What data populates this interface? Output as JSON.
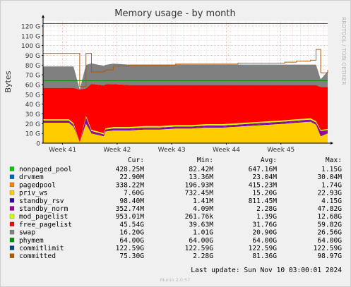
{
  "chart_data": {
    "type": "area",
    "title": "Memory usage - by month",
    "ylabel": "Bytes",
    "watermark": "RRDTOOL / TOBI OETIKER",
    "footer": "Munin 2.0.57",
    "last_update": "Last update: Sun Nov 10 03:00:01 2024",
    "grid": true,
    "ylim": [
      0,
      125
    ],
    "y_unit": "G",
    "y_ticks": [
      "0",
      "10 G",
      "20 G",
      "30 G",
      "40 G",
      "50 G",
      "60 G",
      "70 G",
      "80 G",
      "90 G",
      "100 G",
      "110 G",
      "120 G"
    ],
    "x_ticks": [
      "Week 41",
      "Week 42",
      "Week 43",
      "Week 44",
      "Week 45"
    ],
    "x_range_days": [
      0,
      36.5
    ],
    "x_tick_days": [
      2.5,
      9.5,
      16.5,
      23.5,
      30.5
    ],
    "table_headers": [
      "Cur:",
      "Min:",
      "Avg:",
      "Max:"
    ],
    "legend": [
      {
        "name": "nonpaged_pool",
        "color": "#00cc00",
        "cur": "428.25M",
        "min": "82.42M",
        "avg": "647.16M",
        "max": "1.15G"
      },
      {
        "name": "drvmem",
        "color": "#0066b3",
        "cur": "22.90M",
        "min": "13.36M",
        "avg": "23.04M",
        "max": "30.04M"
      },
      {
        "name": "pagedpool",
        "color": "#ff8000",
        "cur": "338.22M",
        "min": "196.93M",
        "avg": "415.23M",
        "max": "1.74G"
      },
      {
        "name": "priv_ws",
        "color": "#ffcc00",
        "cur": "7.60G",
        "min": "732.45M",
        "avg": "15.20G",
        "max": "22.93G"
      },
      {
        "name": "standby_rsv",
        "color": "#330099",
        "cur": "98.40M",
        "min": "1.41M",
        "avg": "811.45M",
        "max": "4.15G"
      },
      {
        "name": "standby_norm",
        "color": "#990099",
        "cur": "352.74M",
        "min": "4.09M",
        "avg": "2.28G",
        "max": "47.82G"
      },
      {
        "name": "mod_pagelist",
        "color": "#ccff00",
        "cur": "953.01M",
        "min": "261.76k",
        "avg": "1.39G",
        "max": "12.68G"
      },
      {
        "name": "free_pagelist",
        "color": "#ff0000",
        "cur": "45.54G",
        "min": "39.63M",
        "avg": "31.76G",
        "max": "59.82G"
      },
      {
        "name": "swap",
        "color": "#808080",
        "cur": "16.20G",
        "min": "1.01G",
        "avg": "20.90G",
        "max": "26.56G"
      },
      {
        "name": "phymem",
        "color": "#008f00",
        "cur": "64.00G",
        "min": "64.00G",
        "avg": "64.00G",
        "max": "64.00G"
      },
      {
        "name": "commitlimit",
        "color": "#00487d",
        "cur": "122.59G",
        "min": "122.59G",
        "avg": "122.59G",
        "max": "122.59G"
      },
      {
        "name": "committed",
        "color": "#b35a00",
        "cur": "75.30G",
        "min": "2.28G",
        "avg": "81.36G",
        "max": "98.97G"
      }
    ],
    "series_days": [
      0,
      3.3,
      3.9,
      4.7,
      5.5,
      6.2,
      7.8,
      8,
      9,
      11,
      13,
      15,
      17,
      19,
      21,
      23,
      25,
      27,
      29,
      31,
      32.5,
      34.3,
      35,
      35.6,
      36.5
    ],
    "series": [
      {
        "name": "priv_ws",
        "values": [
          21,
          21,
          17,
          1,
          20,
          10,
          7,
          12,
          13,
          13,
          14,
          14,
          15,
          15,
          16,
          16,
          17,
          18,
          19,
          20,
          21,
          22,
          19,
          7,
          10
        ]
      },
      {
        "name": "standby_rsv",
        "values": [
          0.6,
          0.6,
          0.6,
          0,
          0.6,
          0.5,
          0.5,
          0.5,
          0.6,
          0.6,
          0.6,
          0.6,
          0.6,
          0.6,
          0.6,
          0.6,
          0.6,
          0.6,
          0.6,
          0.6,
          0.6,
          0.6,
          0.6,
          0.5,
          0.5
        ]
      },
      {
        "name": "standby_norm",
        "values": [
          1.5,
          1.5,
          1.5,
          0,
          6,
          2,
          1.5,
          1.5,
          1.5,
          1.5,
          1.5,
          1.5,
          1.5,
          1.5,
          1.5,
          1.5,
          1.5,
          1.5,
          1.5,
          1.5,
          1.5,
          1.5,
          1.5,
          5,
          3
        ]
      },
      {
        "name": "mod_pagelist",
        "values": [
          1.5,
          1.5,
          1.5,
          0,
          1.5,
          1.2,
          1.2,
          1.2,
          1.4,
          1.4,
          1.4,
          1.4,
          1.4,
          1.4,
          1.4,
          1.4,
          1.4,
          1.4,
          1.4,
          1.4,
          1.4,
          1.4,
          1.4,
          1,
          1
        ]
      },
      {
        "name": "free_pagelist",
        "values": [
          32,
          32,
          36,
          54,
          28,
          47,
          49,
          45,
          44,
          43,
          42,
          42,
          41,
          41,
          40,
          40,
          39,
          38,
          37,
          36,
          35,
          34,
          37,
          44,
          43
        ]
      },
      {
        "name": "swap",
        "values": [
          22,
          22,
          22,
          0,
          24,
          21,
          20,
          20,
          21,
          21,
          21,
          21,
          21,
          21,
          21,
          21,
          21,
          21,
          21,
          21,
          21,
          21,
          21,
          8,
          16
        ]
      },
      {
        "name": "committed",
        "values": [
          92,
          92,
          92,
          58,
          92,
          73,
          74,
          75,
          79,
          80,
          80,
          80,
          81,
          81,
          81,
          81,
          82,
          82,
          82,
          83,
          84,
          85,
          96,
          72,
          75
        ]
      },
      {
        "name": "phymem",
        "values": [
          64,
          64,
          64,
          64,
          64,
          64,
          64,
          64,
          64,
          64,
          64,
          64,
          64,
          64,
          64,
          64,
          64,
          64,
          64,
          64,
          64,
          64,
          64,
          64,
          64
        ]
      },
      {
        "name": "commitlimit",
        "values": [
          122.59,
          122.59,
          122.59,
          122.59,
          122.59,
          122.59,
          122.59,
          122.59,
          122.59,
          122.59,
          122.59,
          122.59,
          122.59,
          122.59,
          122.59,
          122.59,
          122.59,
          122.59,
          122.59,
          122.59,
          122.59,
          122.59,
          122.59,
          122.59,
          122.59
        ]
      }
    ]
  }
}
